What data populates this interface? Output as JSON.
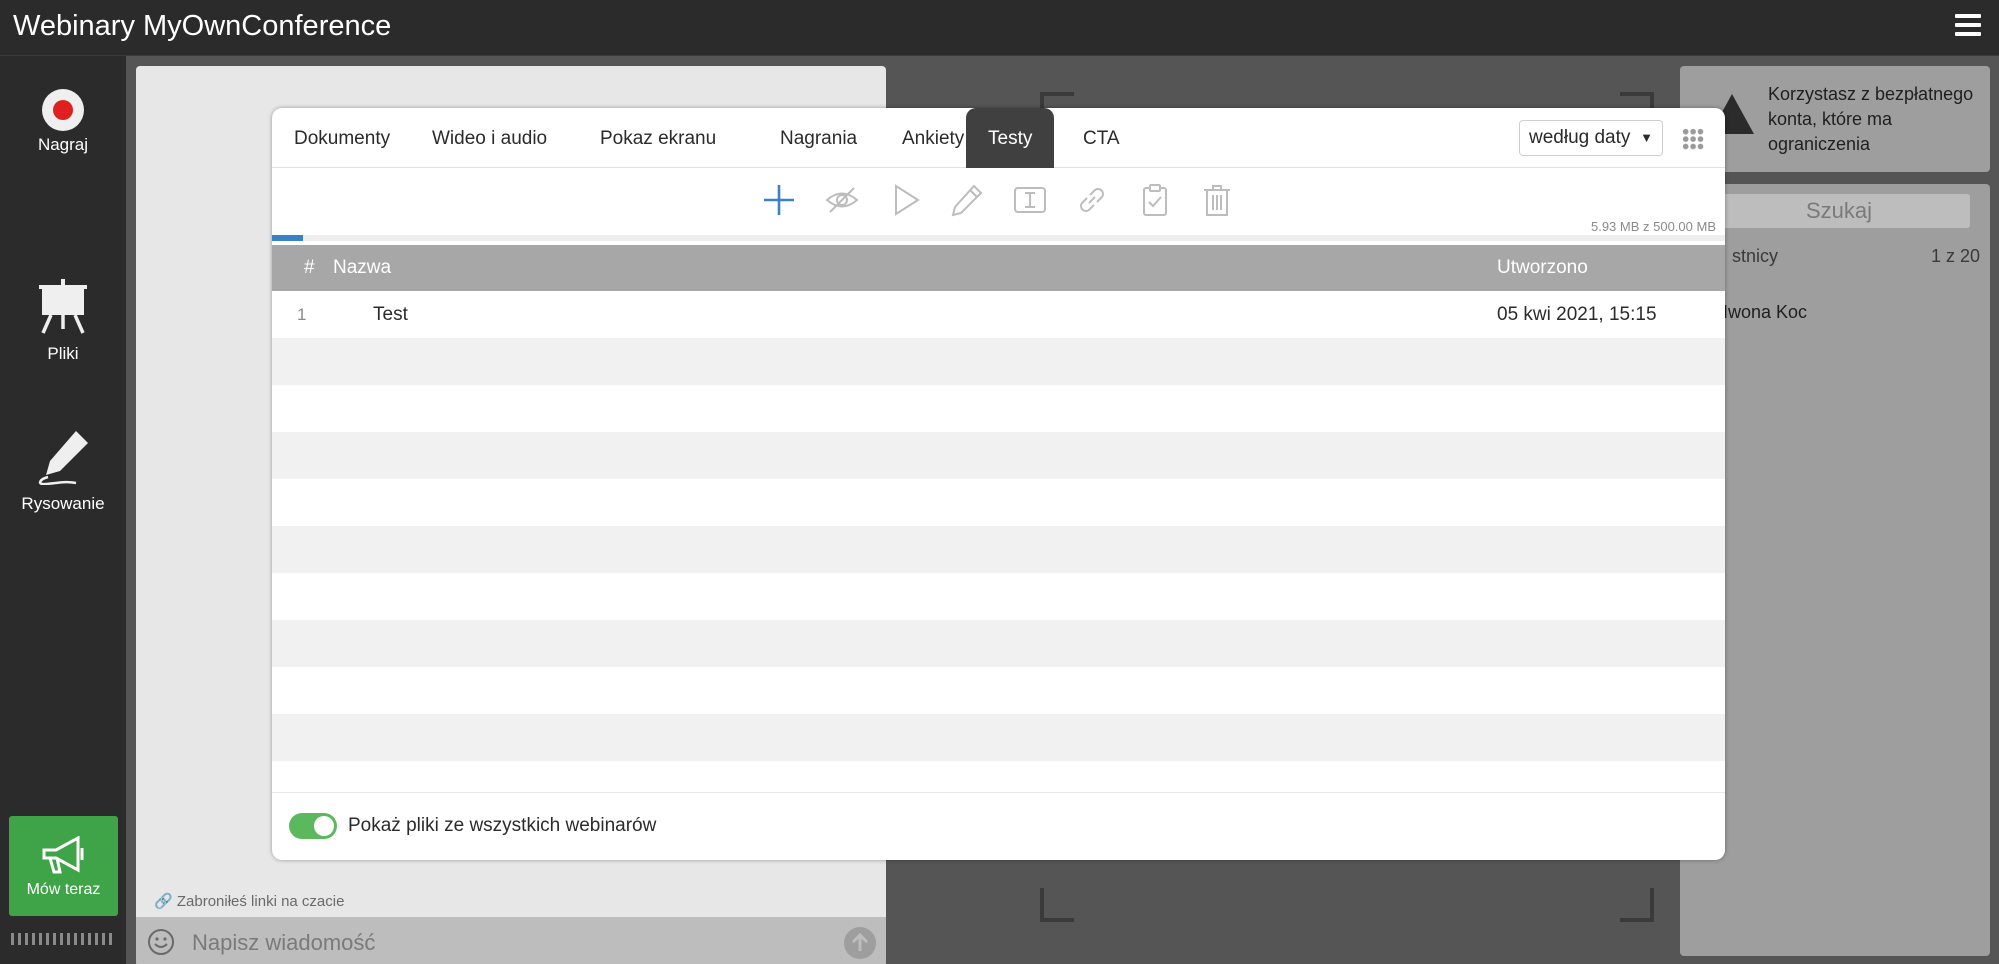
{
  "app": {
    "title": "Webinary MyOwnConference"
  },
  "sidebar": {
    "items": [
      {
        "label": "Nagraj",
        "icon": "record-icon"
      },
      {
        "label": "Pliki",
        "icon": "presentation-board-icon"
      },
      {
        "label": "Rysowanie",
        "icon": "pencil-drawing-icon"
      }
    ],
    "speak_label": "Mów teraz"
  },
  "chat": {
    "note": "Zabroniłeś linki na czacie",
    "placeholder": "Napisz wiadomość"
  },
  "right_panel": {
    "warning": "Korzystasz z bezpłatnego konta, które ma ograniczenia",
    "search_label": "Szukaj",
    "participants_label": "stnicy",
    "participants_count": "1 z 20",
    "participant_name": "Iwona Koc"
  },
  "modal": {
    "tabs": [
      {
        "label": "Dokumenty"
      },
      {
        "label": "Wideo i audio"
      },
      {
        "label": "Pokaz ekranu"
      },
      {
        "label": "Nagrania"
      },
      {
        "label": "Ankiety"
      },
      {
        "label": "Testy",
        "active": true
      },
      {
        "label": "CTA"
      }
    ],
    "sort": {
      "selected": "według daty"
    },
    "storage": "5.93 MB z 500.00 MB",
    "storage_used_fraction": 0.012,
    "table": {
      "headers": {
        "num": "#",
        "name": "Nazwa",
        "date": "Utworzono"
      },
      "rows": [
        {
          "num": "1",
          "name": "Test",
          "date": "05 kwi 2021, 15:15"
        }
      ]
    },
    "footer_toggle_label": "Pokaż pliki ze wszystkich webinarów",
    "footer_toggle_on": true
  },
  "colors": {
    "accent_blue": "#3b82c4",
    "active_tab": "#404040",
    "speak_green": "#3fa447",
    "record_red": "#e02020"
  }
}
